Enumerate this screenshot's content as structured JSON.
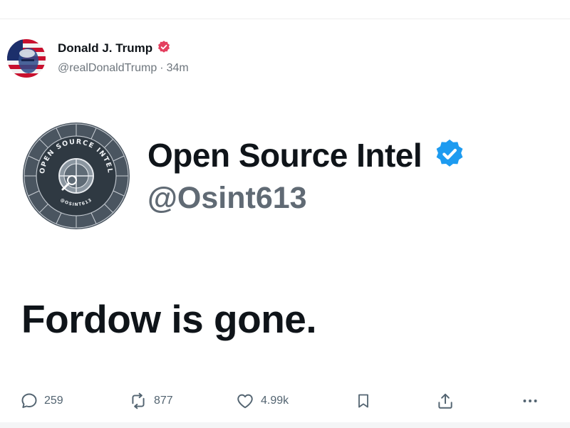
{
  "post": {
    "author_name": "Donald J. Trump",
    "handle": "@realDonaldTrump",
    "separator": "·",
    "time": "34m",
    "verified_color": "#e4405f"
  },
  "embedded": {
    "name": "Open Source Intel",
    "handle": "@Osint613",
    "text": "Fordow is gone.",
    "verified_color": "#1d9bf0",
    "logo": {
      "ring_text": "OPEN SOURCE INTEL",
      "bottom_text": "@OSINT613"
    }
  },
  "actions": {
    "reply": {
      "icon": "comment-icon",
      "count": "259"
    },
    "retweet": {
      "icon": "retweet-icon",
      "count": "877"
    },
    "like": {
      "icon": "heart-icon",
      "count": "4.99k"
    },
    "bookmark": {
      "icon": "bookmark-icon"
    },
    "share": {
      "icon": "share-icon"
    },
    "more": {
      "icon": "more-icon"
    }
  }
}
